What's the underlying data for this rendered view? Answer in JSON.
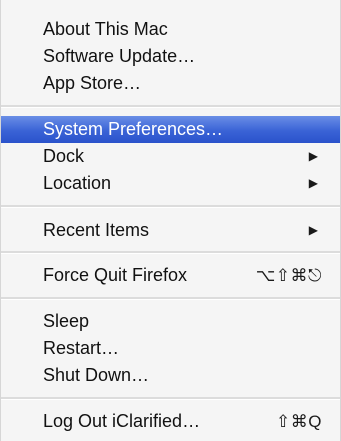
{
  "menu": {
    "about": "About This Mac",
    "software_update": "Software Update…",
    "app_store": "App Store…",
    "system_preferences": "System Preferences…",
    "dock": "Dock",
    "location": "Location",
    "recent_items": "Recent Items",
    "force_quit": "Force Quit Firefox",
    "force_quit_shortcut": "⌥⇧⌘⎋",
    "sleep": "Sleep",
    "restart": "Restart…",
    "shut_down": "Shut Down…",
    "log_out": "Log Out iClarified…",
    "log_out_shortcut": "⇧⌘Q",
    "submenu_arrow": "▶"
  }
}
